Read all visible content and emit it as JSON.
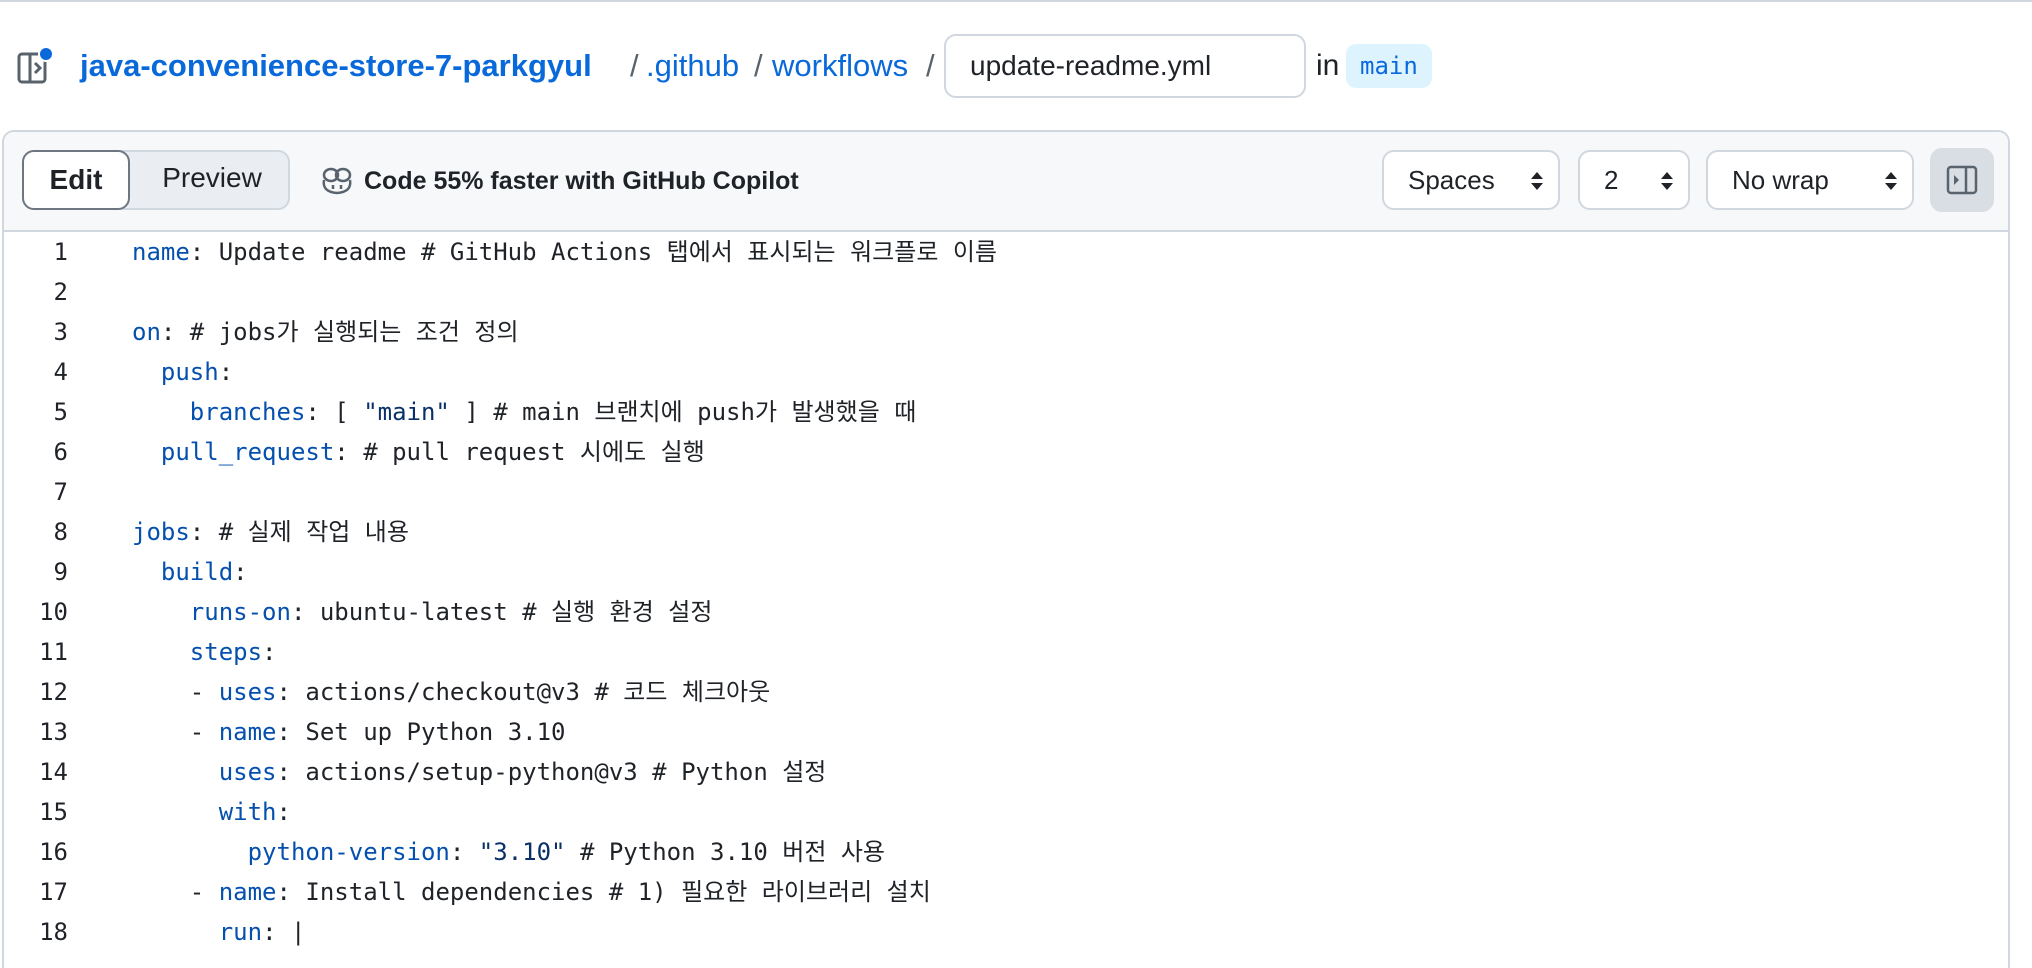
{
  "breadcrumb": {
    "repo": "java-convenience-store-7-parkgyul",
    "sep1": "/",
    "folder1": ".github",
    "sep2": "/",
    "folder2": "workflows",
    "sep3": "/",
    "filename": "update-readme.yml",
    "in_label": "in",
    "branch": "main"
  },
  "toolbar": {
    "edit_label": "Edit",
    "preview_label": "Preview",
    "copilot_label": "Code 55% faster with GitHub Copilot",
    "indent_mode": "Spaces",
    "indent_size": "2",
    "wrap_mode": "No wrap"
  },
  "code": {
    "numbers": [
      "1",
      "2",
      "3",
      "4",
      "5",
      "6",
      "7",
      "8",
      "9",
      "10",
      "11",
      "12",
      "13",
      "14",
      "15",
      "16",
      "17",
      "18"
    ],
    "l1_k": "name",
    "l1_r": ": Update readme # GitHub Actions 탭에서 표시되는 워크플로 이름",
    "l3_k": "on",
    "l3_r": ": # jobs가 실행되는 조건 정의",
    "l4_k": "push",
    "l4_r": ":",
    "l5_k": "branches",
    "l5_a": ": [ ",
    "l5_s": "\"main\"",
    "l5_r": " ] # main 브랜치에 push가 발생했을 때",
    "l6_k": "pull_request",
    "l6_r": ": # pull request 시에도 실행",
    "l8_k": "jobs",
    "l8_r": ": # 실제 작업 내용",
    "l9_k": "build",
    "l9_r": ":",
    "l10_k": "runs-on",
    "l10_r": ": ubuntu-latest # 실행 환경 설정",
    "l11_k": "steps",
    "l11_r": ":",
    "l12_d": "- ",
    "l12_k": "uses",
    "l12_r": ": actions/checkout@v3 # 코드 체크아웃",
    "l13_d": "- ",
    "l13_k": "name",
    "l13_r": ": Set up Python 3.10",
    "l14_k": "uses",
    "l14_r": ": actions/setup-python@v3 # Python 설정",
    "l15_k": "with",
    "l15_r": ":",
    "l16_k": "python-version",
    "l16_a": ": ",
    "l16_s": "\"3.10\"",
    "l16_r": " # Python 3.10 버전 사용",
    "l17_d": "- ",
    "l17_k": "name",
    "l17_r": ": Install dependencies # 1) 필요한 라이브러리 설치",
    "l18_k": "run",
    "l18_r": ": |"
  }
}
